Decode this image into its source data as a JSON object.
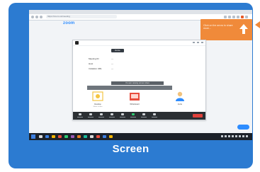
{
  "caption": "Screen",
  "browser": {
    "url": "https://zoom.us/meeting"
  },
  "zoom": {
    "logo_text": "zoom",
    "notification": "Click on the arrow to share more..."
  },
  "window": {
    "home_tab": "Home",
    "rows": [
      {
        "label": "Meeting ID",
        "value": "—"
      },
      {
        "label": "Host",
        "value": "—"
      },
      {
        "label": "Invitation URL",
        "value": "—"
      }
    ],
    "share_text": "You are viewing screen share",
    "options": [
      {
        "label": "Desktop",
        "sub": "Share screen",
        "color": "#f4c542"
      },
      {
        "label": "Whiteboard",
        "sub": "",
        "color": "#e84c3d"
      },
      {
        "label": "Invite",
        "sub": "",
        "color": "#2d8cff"
      }
    ]
  },
  "colors": {
    "card": "#2c7bd1",
    "accent_orange": "#f08a3a",
    "zoom_blue": "#2d8cff"
  }
}
